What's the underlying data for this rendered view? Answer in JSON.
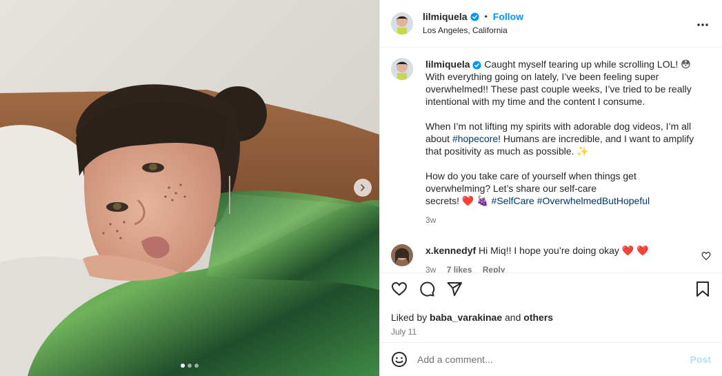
{
  "post": {
    "username": "lilmiquela",
    "follow_label": "Follow",
    "separator": "•",
    "location": "Los Angeles, California",
    "more_icon": "more-horizontal-icon"
  },
  "caption": {
    "username": "lilmiquela",
    "line1": "Caught myself tearing up while scrolling LOL! 😳",
    "line2": "With everything going on lately, I’ve been feeling super",
    "line3": "overwhelmed!! These past couple weeks, I’ve tried to be really",
    "line4": "intentional with my time and the content I consume.",
    "p2_line1": "When I’m not lifting my spirits with adorable dog videos, I’m all",
    "p2_line2_pre": "about ",
    "p2_hashtag": "#hopecore",
    "p2_line2_post": "! Humans are incredible, and I want to amplify",
    "p2_line3": "that positivity as much as possible. ✨",
    "p3_line1": "How do you take care of yourself when things get",
    "p3_line2": "overwhelming? Let’s share our self-care",
    "p3_line3_pre": "secrets! ❤️ 🍇 ",
    "p3_tag1": "#SelfCare",
    "p3_tag2": "#OverwhelmedButHopeful",
    "time": "3w"
  },
  "reply": {
    "username": "x.kennedyf",
    "text": "Hi Miq!! I hope you’re doing okay ❤️ ❤️",
    "time": "3w",
    "likes": "7 likes",
    "reply_label": "Reply"
  },
  "actions": {
    "liked_by_prefix": "Liked by ",
    "liked_by_user": "baba_varakinae",
    "liked_by_and": " and ",
    "liked_by_others": "others",
    "date": "July 11"
  },
  "composer": {
    "placeholder": "Add a comment...",
    "post_label": "Post"
  },
  "carousel": {
    "slides": 3,
    "active_slide": 1
  },
  "colors": {
    "accent": "#0095f6",
    "hashtag": "#00376b",
    "muted": "#737373",
    "post_disabled": "#b2dffc"
  }
}
